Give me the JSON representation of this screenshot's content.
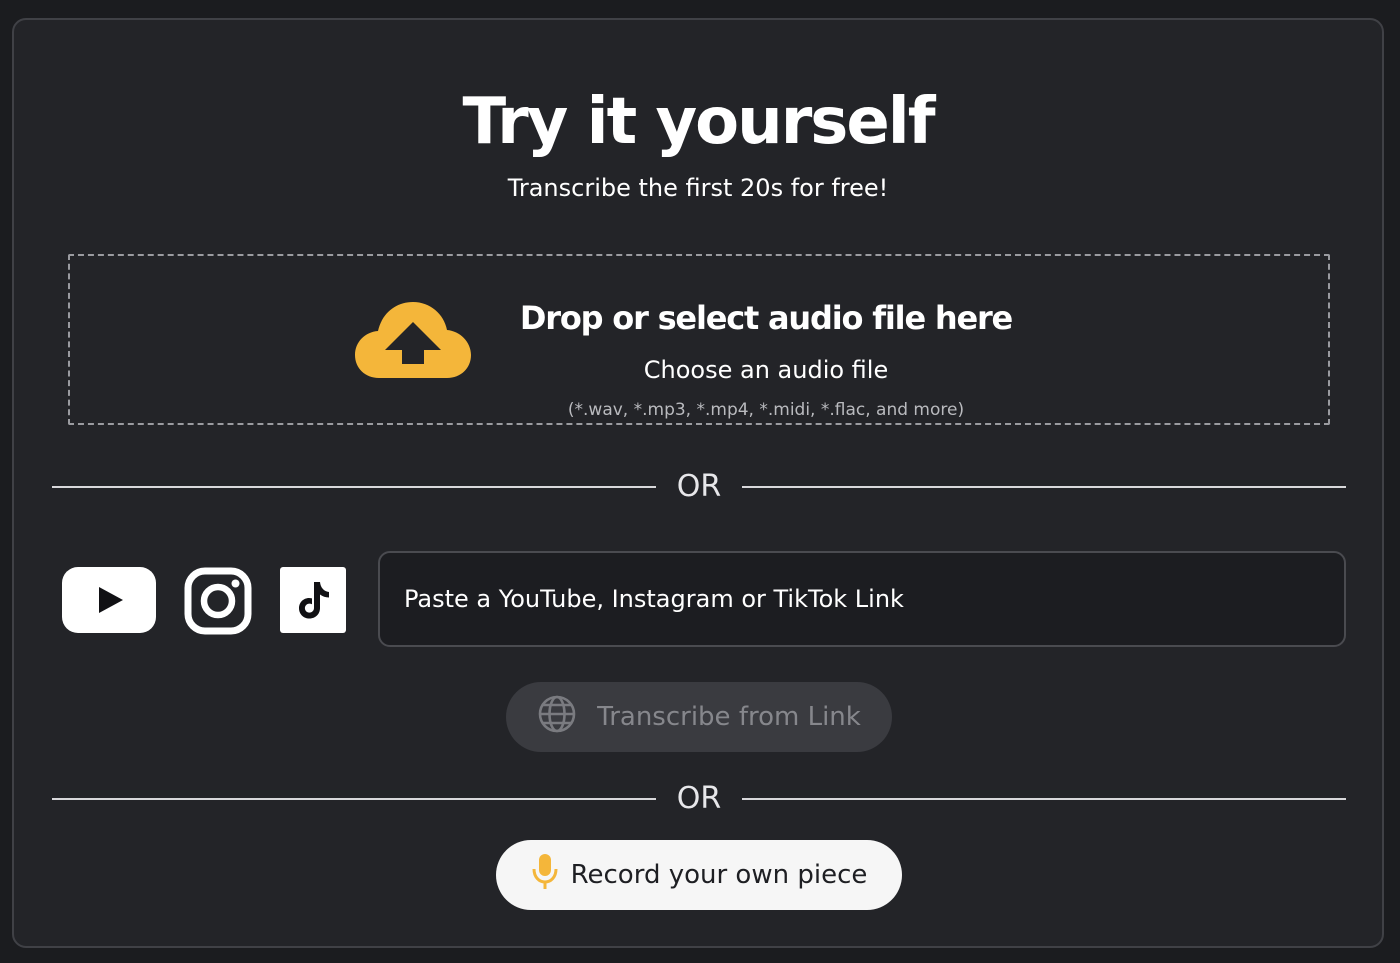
{
  "header": {
    "title": "Try it yourself",
    "subtitle": "Transcribe the first 20s for free!"
  },
  "dropzone": {
    "title": "Drop or select audio file here",
    "choose_label": "Choose an audio file",
    "formats": "(*.wav, *.mp3, *.mp4, *.midi, *.flac, and more)",
    "icon": "cloud-upload-icon"
  },
  "dividers": {
    "first": "OR",
    "second": "OR"
  },
  "link_section": {
    "icons": [
      "youtube-icon",
      "instagram-icon",
      "tiktok-icon"
    ],
    "input_value": "",
    "input_placeholder": "Paste a YouTube, Instagram or TikTok Link",
    "transcribe_button": "Transcribe from Link",
    "transcribe_icon": "globe-icon"
  },
  "record": {
    "button_label": "Record your own piece",
    "icon": "microphone-icon"
  },
  "colors": {
    "accent": "#f4b63a",
    "background": "#232428",
    "text": "#ffffff"
  }
}
